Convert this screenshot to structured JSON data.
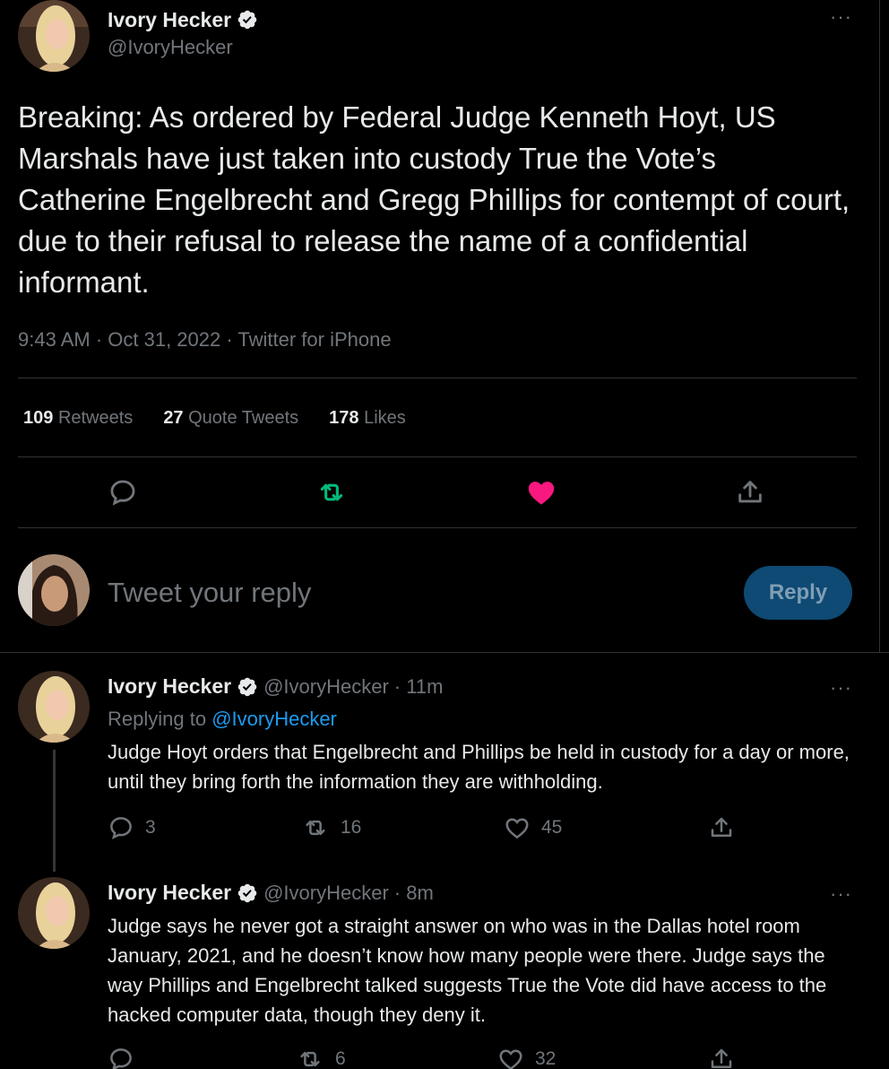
{
  "main_tweet": {
    "author_name": "Ivory Hecker",
    "author_handle": "@IvoryHecker",
    "more": "···",
    "text": "Breaking: As ordered by Federal Judge Kenneth Hoyt, US Marshals have just taken into custody True the Vote’s Catherine Engelbrecht and Gregg Phillips for contempt of court, due to their refusal to release the name of a confidential informant.",
    "meta": "9:43 AM · Oct 31, 2022 · Twitter for iPhone",
    "stats": {
      "retweets_count": "109",
      "retweets_label": "Retweets",
      "quotes_count": "27",
      "quotes_label": "Quote Tweets",
      "likes_count": "178",
      "likes_label": "Likes"
    },
    "colors": {
      "retweet": "#00ba7c",
      "like": "#f91880"
    }
  },
  "composer": {
    "placeholder": "Tweet your reply",
    "button_label": "Reply"
  },
  "replies": [
    {
      "author_name": "Ivory Hecker",
      "author_handle": "@IvoryHecker",
      "time": "· 11m",
      "replying_label": "Replying to ",
      "replying_to": "@IvoryHecker",
      "text": "Judge Hoyt orders that Engelbrecht and Phillips be held in custody for a day or more, until they bring forth the information they are withholding.",
      "replies": "3",
      "retweets": "16",
      "likes": "45",
      "more": "···"
    },
    {
      "author_name": "Ivory Hecker",
      "author_handle": "@IvoryHecker",
      "time": "· 8m",
      "text": "Judge says he never got a straight answer on who was in the Dallas hotel room January, 2021, and he doesn’t know how many people were there. Judge says the way Phillips and Engelbrecht talked suggests True the Vote did have access to the hacked computer data, though they deny it.",
      "replies": "",
      "retweets": "6",
      "likes": "32",
      "more": "···"
    }
  ]
}
